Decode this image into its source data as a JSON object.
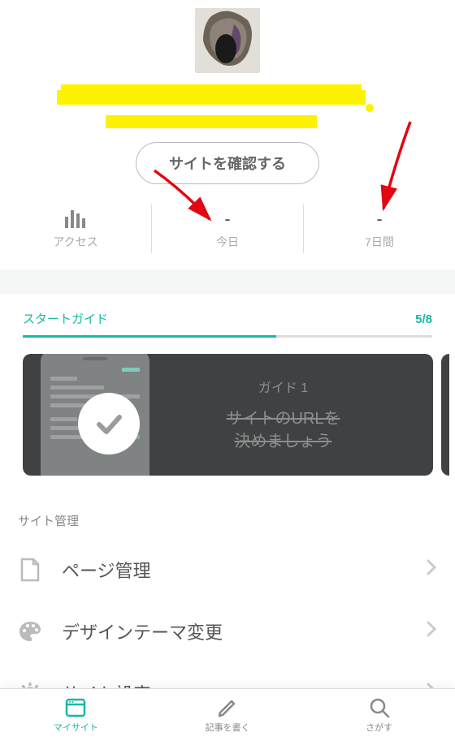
{
  "header": {
    "redacted_title_line1": "████████████",
    "redacted_title_line2": "████████",
    "view_site_button": "サイトを確認する"
  },
  "stats": {
    "access": {
      "label": "アクセス",
      "value_icon": "bar-chart-icon"
    },
    "today": {
      "label": "今日",
      "value": "-"
    },
    "seven_days": {
      "label": "7日間",
      "value": "-"
    }
  },
  "start_guide": {
    "title": "スタートガイド",
    "progress_text": "5/8",
    "progress_percent": 62,
    "card": {
      "subtitle": "ガイド 1",
      "line1": "サイトのURLを",
      "line2": "決めましょう"
    }
  },
  "site_manage": {
    "section_title": "サイト管理",
    "items": [
      {
        "icon": "page-icon",
        "label": "ページ管理"
      },
      {
        "icon": "palette-icon",
        "label": "デザインテーマ変更"
      },
      {
        "icon": "gear-icon",
        "label": "サイト設定"
      }
    ]
  },
  "bottom_nav": {
    "items": [
      {
        "icon": "mysite-icon",
        "label": "マイサイト",
        "active": true
      },
      {
        "icon": "write-icon",
        "label": "記事を書く",
        "active": false
      },
      {
        "icon": "search-icon",
        "label": "さがす",
        "active": false
      }
    ]
  },
  "colors": {
    "accent": "#17b9a5",
    "highlighter": "#fdf300",
    "annotation_red": "#e30613"
  }
}
